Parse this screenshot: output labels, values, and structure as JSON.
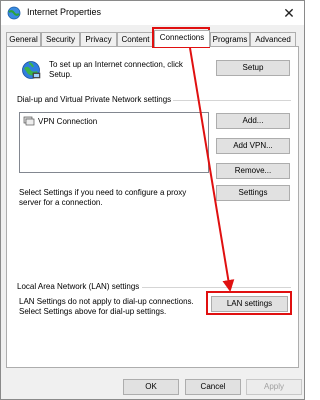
{
  "window": {
    "title": "Internet Properties",
    "close_glyph": "✕"
  },
  "tabs": [
    {
      "label": "General"
    },
    {
      "label": "Security"
    },
    {
      "label": "Privacy"
    },
    {
      "label": "Content"
    },
    {
      "label": "Connections",
      "active": true
    },
    {
      "label": "Programs"
    },
    {
      "label": "Advanced"
    }
  ],
  "setup": {
    "text_line1": "To set up an Internet connection, click",
    "text_line2": "Setup.",
    "button": "Setup",
    "icon": "globe-network-icon"
  },
  "dialup": {
    "section_label": "Dial-up and Virtual Private Network settings",
    "list_items": [
      {
        "label": "VPN Connection",
        "icon": "vpn-connection-icon"
      }
    ],
    "add_button": "Add...",
    "add_vpn_button": "Add VPN...",
    "remove_button": "Remove...",
    "proxy_text_line1": "Select Settings if you need to configure a proxy",
    "proxy_text_line2": "server for a connection.",
    "settings_button": "Settings"
  },
  "lan": {
    "section_label": "Local Area Network (LAN) settings",
    "text_line1": "LAN Settings do not apply to dial-up connections.",
    "text_line2": "Select Settings above for dial-up settings.",
    "button": "LAN settings"
  },
  "footer": {
    "ok": "OK",
    "cancel": "Cancel",
    "apply": "Apply"
  },
  "annotation": {
    "highlight_color": "#e01010"
  }
}
